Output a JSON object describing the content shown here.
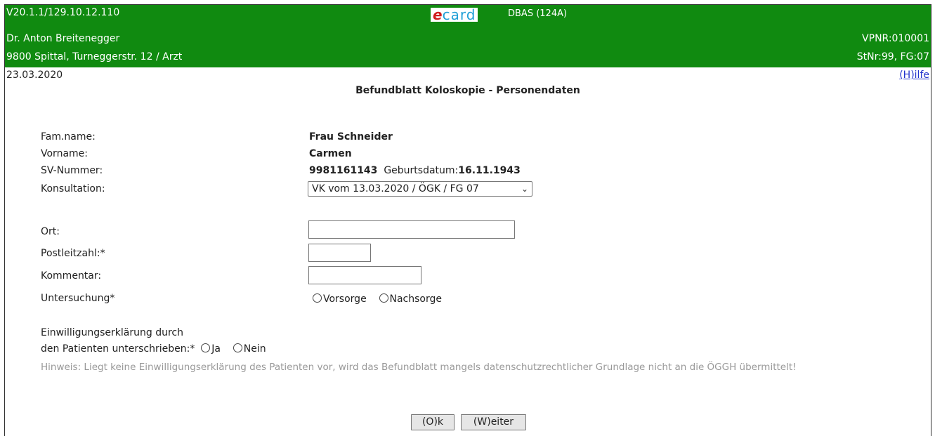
{
  "header": {
    "version_ip": "V20.1.1/129.10.12.110",
    "logo_e": "e",
    "logo_card": "card",
    "system_label": "DBAS (124A)",
    "doctor_name": "Dr. Anton Breitenegger",
    "vpnr": "VPNR:010001",
    "address": "9800 Spittal, Turneggerstr. 12 / Arzt",
    "stnr": "StNr:99, FG:07",
    "bg_color": "#108a10"
  },
  "date": "23.03.2020",
  "help_link": "(H)ilfe",
  "page_title": "Befundblatt Koloskopie - Personendaten",
  "person": {
    "famname_label": "Fam.name:",
    "famname_value": "Frau Schneider",
    "vorname_label": "Vorname:",
    "vorname_value": "Carmen",
    "sv_label": "SV-Nummer:",
    "sv_value": "9981161143",
    "geburtsdatum_label": "Geburtsdatum:",
    "geburtsdatum_value": "16.11.1943",
    "konsultation_label": "Konsultation:",
    "konsultation_value": "VK vom 13.03.2020 / ÖGK / FG 07"
  },
  "form": {
    "ort_label": "Ort:",
    "ort_value": "",
    "plz_label": "Postleitzahl:*",
    "plz_value": "",
    "kommentar_label": "Kommentar:",
    "kommentar_value": "",
    "untersuchung_label": "Untersuchung*",
    "untersuchung_options": [
      "Vorsorge",
      "Nachsorge"
    ],
    "einwilligung_label_line1": "Einwilligungserklärung durch",
    "einwilligung_label_line2": "den Patienten unterschrieben:*",
    "einwilligung_options": [
      "Ja",
      "Nein"
    ],
    "hint_text": "Hinweis: Liegt keine Einwilligungserklärung des Patienten vor, wird das Befundblatt mangels datenschutzrechtlicher Grundlage nicht an die ÖGGH übermittelt!"
  },
  "buttons": {
    "ok_label": "(O)k",
    "weiter_label": "(W)eiter"
  }
}
